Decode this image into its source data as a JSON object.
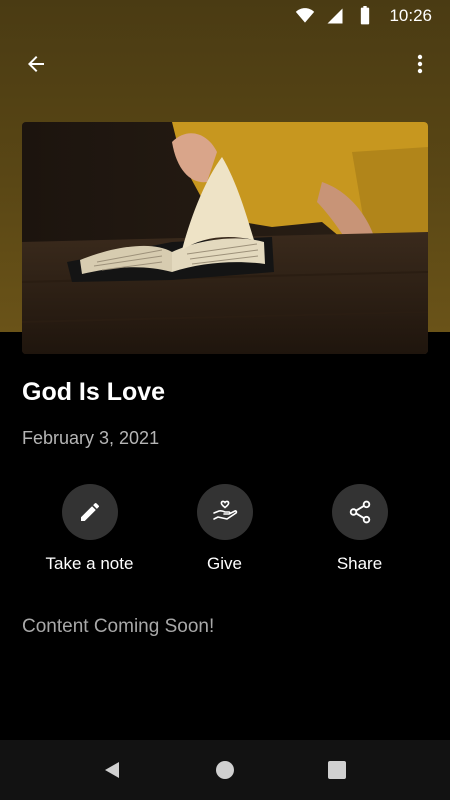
{
  "status_bar": {
    "time": "10:26"
  },
  "article": {
    "title": "God Is Love",
    "date": "February 3, 2021",
    "content_placeholder": "Content Coming Soon!"
  },
  "actions": [
    {
      "label": "Take a note",
      "icon": "pencil-icon"
    },
    {
      "label": "Give",
      "icon": "hand-heart-icon"
    },
    {
      "label": "Share",
      "icon": "share-icon"
    }
  ],
  "colors": {
    "hero_tint": "#5a4715",
    "background": "#000000",
    "action_circle": "#333333",
    "date_text": "#b5b5b5"
  }
}
